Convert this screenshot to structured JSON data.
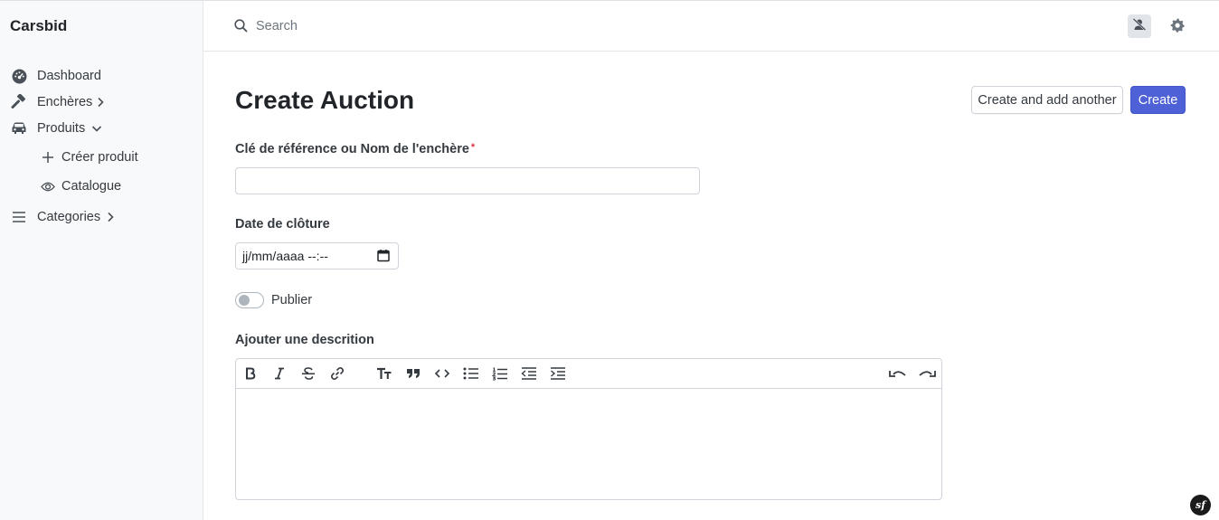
{
  "app": {
    "brand": "Carsbid"
  },
  "sidebar": {
    "items": [
      {
        "label": "Dashboard",
        "icon": "dashboard-icon"
      },
      {
        "label": "Enchères",
        "icon": "gavel-icon",
        "chevron": "right"
      },
      {
        "label": "Produits",
        "icon": "car-icon",
        "chevron": "down"
      },
      {
        "label": "Categories",
        "icon": "list-icon",
        "chevron": "right"
      }
    ],
    "subitems": [
      {
        "label": "Créer produit",
        "icon": "plus-icon"
      },
      {
        "label": "Catalogue",
        "icon": "eye-icon"
      }
    ]
  },
  "topbar": {
    "search_placeholder": "Search",
    "avatar_icon": "user-slash-icon",
    "settings_icon": "gear-icon"
  },
  "page": {
    "title": "Create Auction",
    "btn_add_another": "Create and add another",
    "btn_create": "Create"
  },
  "form": {
    "name_label": "Clé de référence ou Nom de l'enchère",
    "name_required": "*",
    "name_value": "",
    "date_label": "Date de clôture",
    "date_placeholder": "jj/mm/aaaa --:--",
    "publish_label": "Publier",
    "publish_checked": false,
    "description_label": "Ajouter une descrition",
    "description_value": ""
  },
  "colors": {
    "primary": "#4f61d6",
    "sidebar_bg": "#f8f9fa",
    "required": "#dc3545"
  },
  "footer": {
    "symfony_badge": "sf"
  }
}
